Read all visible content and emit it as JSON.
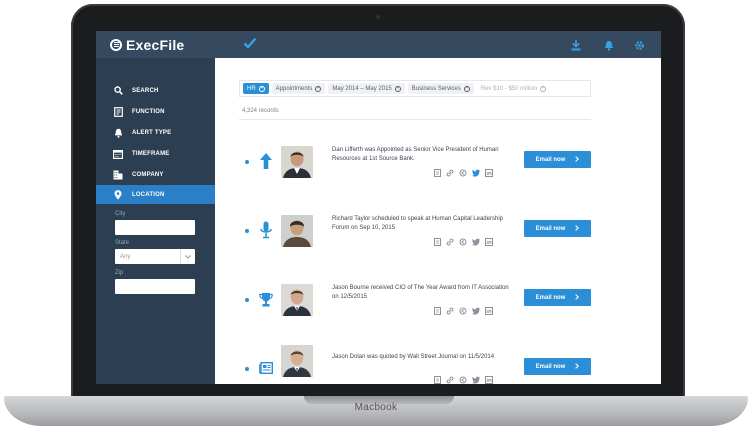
{
  "device": {
    "brand_label": "Macbook"
  },
  "topbar": {
    "logo_text": "ExecFile",
    "icons": [
      "check-icon",
      "download-icon",
      "bell-icon",
      "gear-icon"
    ],
    "background": "#35495f"
  },
  "sidebar": {
    "items": [
      {
        "label": "SEARCH",
        "icon": "search-icon"
      },
      {
        "label": "FUNCTION",
        "icon": "function-icon"
      },
      {
        "label": "ALERT TYPE",
        "icon": "bell-icon"
      },
      {
        "label": "TIMEFRAME",
        "icon": "calendar-icon"
      },
      {
        "label": "COMPANY",
        "icon": "building-icon"
      },
      {
        "label": "LOCATION",
        "icon": "location-pin-icon",
        "active": true
      }
    ],
    "location_form": {
      "city_label": "City",
      "city_value": "",
      "state_label": "State",
      "state_value": "Any",
      "zip_label": "Zip",
      "zip_value": ""
    },
    "background": "#2c3e52",
    "active_color": "#2a7fc6"
  },
  "filters": {
    "chips": [
      {
        "label": "HR",
        "highlighted": true
      },
      {
        "label": "Appointments"
      },
      {
        "label": "May 2014 – May 2015"
      },
      {
        "label": "Business Services"
      },
      {
        "label": "Rev $10 - $50 million",
        "muted": true
      }
    ]
  },
  "records_count": "4,324 records",
  "feed": [
    {
      "icon": "arrow-up-icon",
      "text": "Dan Lifferth was Appointed as Senior Vice President of Human Resources at 1st Source Bank.",
      "button": "Email now"
    },
    {
      "icon": "microphone-icon",
      "text": "Richard Taylor scheduled to speak at Human Capital Leadership Forum on Sep 10, 2015",
      "button": "Email now"
    },
    {
      "icon": "trophy-icon",
      "text": "Jason Bourne received CIO of The Year Award from IT Association on 12/5/2015",
      "button": "Email now"
    },
    {
      "icon": "newspaper-icon",
      "text": "Jason Dolan was quoted by Wall Street Journal on 11/5/2014",
      "button": "Email now"
    }
  ],
  "accent_color": "#2a8fd6"
}
